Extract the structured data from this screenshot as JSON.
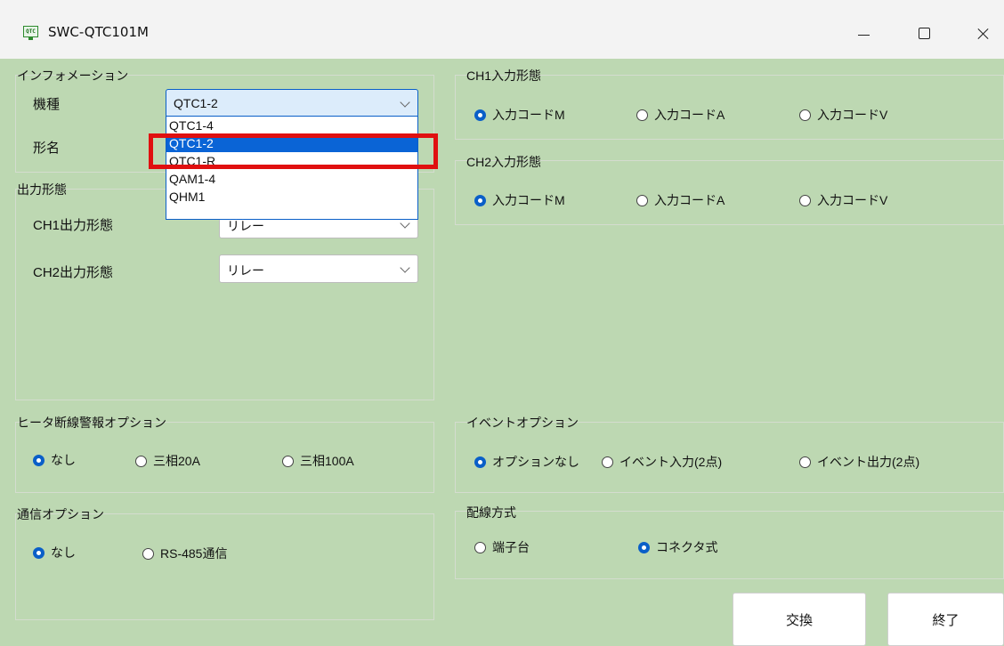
{
  "window": {
    "title": "SWC-QTC101M",
    "icon_text": "QTC"
  },
  "info": {
    "legend": "インフォメーション",
    "model_label": "機種",
    "name_label": "形名",
    "model_value": "QTC1-2",
    "dropdown_options": [
      "QTC1-4",
      "QTC1-2",
      "QTC1-R",
      "QAM1-4",
      "QHM1"
    ],
    "selected_option": "QTC1-2"
  },
  "output": {
    "legend": "出力形態",
    "ch1_label": "CH1出力形態",
    "ch1_value": "リレー",
    "ch2_label": "CH2出力形態",
    "ch2_value": "リレー"
  },
  "ch1_input": {
    "legend": "CH1入力形態",
    "options": [
      "入力コードM",
      "入力コードA",
      "入力コードV"
    ],
    "selected": "入力コードM"
  },
  "ch2_input": {
    "legend": "CH2入力形態",
    "options": [
      "入力コードM",
      "入力コードA",
      "入力コードV"
    ],
    "selected": "入力コードM"
  },
  "heater": {
    "legend": "ヒータ断線警報オプション",
    "options": [
      "なし",
      "三相20A",
      "三相100A"
    ],
    "selected": "なし"
  },
  "event": {
    "legend": "イベントオプション",
    "options": [
      "オプションなし",
      "イベント入力(2点)",
      "イベント出力(2点)"
    ],
    "selected": "オプションなし"
  },
  "comm": {
    "legend": "通信オプション",
    "options": [
      "なし",
      "RS-485通信"
    ],
    "selected": "なし"
  },
  "wiring": {
    "legend": "配線方式",
    "options": [
      "端子台",
      "コネクタ式"
    ],
    "selected": "コネクタ式"
  },
  "buttons": {
    "exchange": "交換",
    "exit": "終了"
  },
  "colors": {
    "panel": "#bdd8b2",
    "accent": "#0a5fc8",
    "highlight": "#e01010"
  }
}
